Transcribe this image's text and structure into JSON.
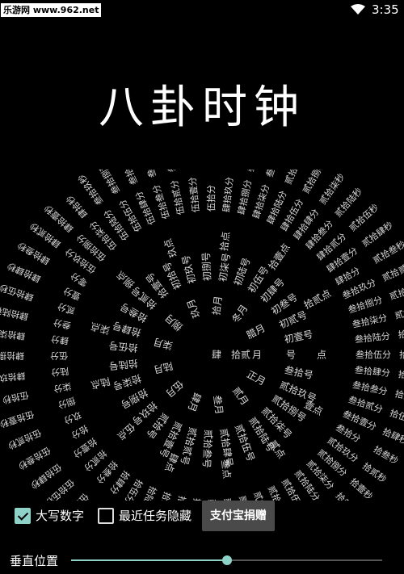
{
  "status_bar": {
    "watermark": "乐游网 www.962.net",
    "wifi_icon": "wifi-icon",
    "time": "3:35"
  },
  "title": "八卦时钟",
  "clock": {
    "rings": [
      {
        "name": "month",
        "items": [
          "月",
          "腊月",
          "冬月",
          "拾月",
          "玖月",
          "捌月",
          "柒月",
          "陆月",
          "伍月",
          "肆月",
          "叁月",
          "贰月",
          "正月"
        ]
      },
      {
        "name": "day",
        "items": [
          "号",
          "初壹号",
          "初贰号",
          "初叁号",
          "初肆号",
          "初伍号",
          "初陆号",
          "初柒号",
          "初捌号",
          "初玖号",
          "初拾号",
          "拾壹号",
          "拾贰号",
          "拾叁号",
          "拾肆号",
          "拾伍号",
          "拾陆号",
          "拾柒号",
          "拾捌号",
          "拾玖号",
          "贰拾号",
          "贰拾壹号",
          "贰拾贰号",
          "贰拾叁号",
          "贰拾肆号",
          "贰拾伍号",
          "贰拾陆号",
          "贰拾柒号",
          "贰拾捌号",
          "贰拾玖号",
          "叁拾号"
        ]
      },
      {
        "name": "hour",
        "items": [
          "点",
          "拾贰点",
          "拾壹点",
          "拾点",
          "玖点",
          "捌点",
          "柒点",
          "陆点",
          "伍点",
          "肆点",
          "叁点",
          "贰点",
          "壹点"
        ]
      },
      {
        "name": "minute",
        "items": [
          "叁拾伍分",
          "叁拾陆分",
          "叁拾柒分",
          "叁拾捌分",
          "叁拾玖分",
          "肆拾分",
          "肆拾壹分",
          "肆拾贰分",
          "肆拾叁分",
          "肆拾肆分",
          "肆拾伍分",
          "肆拾陆分",
          "肆拾柒分",
          "肆拾捌分",
          "肆拾玖分",
          "伍拾分",
          "伍拾壹分",
          "伍拾贰分",
          "伍拾叁分",
          "伍拾肆分",
          "伍拾伍分",
          "伍拾陆分",
          "伍拾柒分",
          "伍拾捌分",
          "伍拾玖分",
          "零分",
          "壹分",
          "贰分",
          "叁分",
          "肆分",
          "伍分",
          "陆分",
          "柒分",
          "捌分",
          "玖分",
          "拾分",
          "拾壹分",
          "拾贰分",
          "拾叁分",
          "拾肆分",
          "拾伍分",
          "拾陆分",
          "拾柒分",
          "拾捌分",
          "拾玖分",
          "贰拾分",
          "贰拾壹分",
          "贰拾贰分",
          "贰拾叁分",
          "贰拾肆分",
          "贰拾伍分",
          "贰拾陆分",
          "贰拾柒分",
          "贰拾捌分",
          "贰拾玖分",
          "叁拾分",
          "叁拾壹分",
          "叁拾贰分",
          "叁拾叁分",
          "叁拾肆分"
        ]
      },
      {
        "name": "second",
        "items": [
          "拾捌秒",
          "拾玖秒",
          "贰拾秒",
          "贰拾壹秒",
          "贰拾贰秒",
          "贰拾叁秒",
          "贰拾肆秒",
          "贰拾伍秒",
          "贰拾陆秒",
          "贰拾柒秒",
          "贰拾捌秒",
          "贰拾玖秒",
          "叁拾秒",
          "叁拾壹秒",
          "叁拾贰秒",
          "叁拾叁秒",
          "叁拾肆秒",
          "叁拾伍秒",
          "叁拾陆秒",
          "叁拾柒秒",
          "叁拾捌秒",
          "叁拾玖秒",
          "肆拾秒",
          "肆拾壹秒",
          "肆拾贰秒",
          "肆拾叁秒",
          "肆拾肆秒",
          "肆拾伍秒",
          "肆拾陆秒",
          "肆拾柒秒",
          "肆拾捌秒",
          "肆拾玖秒",
          "伍拾秒",
          "伍拾壹秒",
          "伍拾贰秒",
          "伍拾叁秒",
          "伍拾肆秒",
          "伍拾伍秒",
          "伍拾陆秒",
          "伍拾柒秒",
          "伍拾捌秒",
          "伍拾玖秒",
          "零秒",
          "壹秒",
          "贰秒",
          "叁秒",
          "肆秒",
          "伍秒",
          "陆秒",
          "柒秒",
          "捌秒",
          "玖秒",
          "拾秒",
          "拾壹秒",
          "拾贰秒",
          "拾叁秒",
          "拾肆秒",
          "拾伍秒",
          "拾陆秒",
          "拾柒秒"
        ]
      }
    ],
    "center_items": [
      "肆",
      "拾贰"
    ]
  },
  "controls": {
    "uppercase_digits": {
      "label": "大写数字",
      "checked": true
    },
    "hide_recent_tasks": {
      "label": "最近任务隐藏",
      "checked": false
    },
    "donate_label": "支付宝捐赠"
  },
  "vertical_position": {
    "label": "垂直位置",
    "value": 0.5
  },
  "colors": {
    "accent": "#8fd3c8",
    "background": "#000000",
    "text": "#e8e8e8"
  }
}
